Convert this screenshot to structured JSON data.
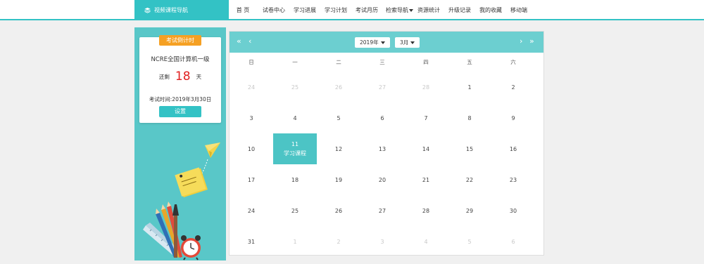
{
  "brand": {
    "label": "视频课程导航",
    "icon": "book-stack-icon"
  },
  "nav": [
    {
      "label": "首 页",
      "active": false
    },
    {
      "label": "试卷中心",
      "active": false
    },
    {
      "label": "学习进展",
      "active": false
    },
    {
      "label": "学习计划",
      "active": true
    },
    {
      "label": "考试月历",
      "active": false
    },
    {
      "label": "检索导航",
      "active": false,
      "dropdown": true
    },
    {
      "label": "资源统计",
      "active": false
    },
    {
      "label": "升级记录",
      "active": false
    },
    {
      "label": "我的收藏",
      "active": false
    },
    {
      "label": "移动端",
      "active": false
    }
  ],
  "countdown": {
    "tag": "考试倒计时",
    "exam_name": "NCRE全国计算机一级",
    "remain_prefix": "还剩",
    "remain_days": "18",
    "remain_suffix": "天",
    "exam_time": "考试时间:2019年3月30日",
    "set_button": "设置"
  },
  "calendar": {
    "prev_year": "«",
    "prev_month": "‹",
    "next_month": "›",
    "next_year": "»",
    "year_select": "2019年",
    "month_select": "3月",
    "weekdays": [
      "日",
      "一",
      "二",
      "三",
      "四",
      "五",
      "六"
    ],
    "weeks": [
      [
        {
          "d": "24",
          "m": true
        },
        {
          "d": "25",
          "m": true
        },
        {
          "d": "26",
          "m": true
        },
        {
          "d": "27",
          "m": true
        },
        {
          "d": "28",
          "m": true
        },
        {
          "d": "1"
        },
        {
          "d": "2"
        }
      ],
      [
        {
          "d": "3"
        },
        {
          "d": "4"
        },
        {
          "d": "5"
        },
        {
          "d": "6"
        },
        {
          "d": "7"
        },
        {
          "d": "8"
        },
        {
          "d": "9"
        }
      ],
      [
        {
          "d": "10"
        },
        {
          "d": "11",
          "event": "学习课程"
        },
        {
          "d": "12"
        },
        {
          "d": "13"
        },
        {
          "d": "14"
        },
        {
          "d": "15"
        },
        {
          "d": "16"
        }
      ],
      [
        {
          "d": "17"
        },
        {
          "d": "18"
        },
        {
          "d": "19"
        },
        {
          "d": "20"
        },
        {
          "d": "21"
        },
        {
          "d": "22"
        },
        {
          "d": "23"
        }
      ],
      [
        {
          "d": "24"
        },
        {
          "d": "25"
        },
        {
          "d": "26"
        },
        {
          "d": "27"
        },
        {
          "d": "28"
        },
        {
          "d": "29"
        },
        {
          "d": "30"
        }
      ],
      [
        {
          "d": "31"
        },
        {
          "d": "1",
          "m": true
        },
        {
          "d": "2",
          "m": true
        },
        {
          "d": "3",
          "m": true
        },
        {
          "d": "4",
          "m": true
        },
        {
          "d": "5",
          "m": true
        },
        {
          "d": "6",
          "m": true
        }
      ]
    ]
  },
  "colors": {
    "accent": "#33c2c5",
    "panel": "#59c7c8",
    "countdown_tag": "#f5a023",
    "countdown_number": "#e02020"
  }
}
